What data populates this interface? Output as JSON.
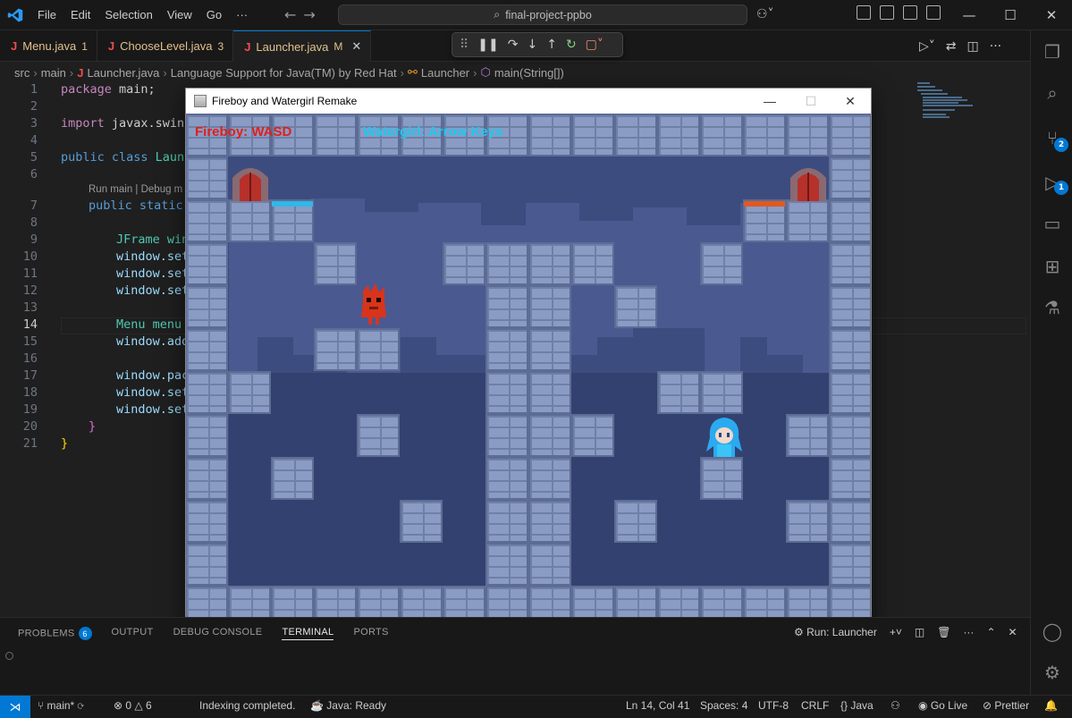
{
  "titlebar": {
    "menu": [
      "File",
      "Edit",
      "Selection",
      "View",
      "Go",
      "···"
    ],
    "search_text": "final-project-ppbo"
  },
  "tabs": [
    {
      "label": "Menu.java",
      "status": "1"
    },
    {
      "label": "ChooseLevel.java",
      "status": "3"
    },
    {
      "label": "Launcher.java",
      "status": "M"
    }
  ],
  "breadcrumb": [
    "src",
    "main",
    "Launcher.java",
    "Language Support for Java(TM) by Red Hat",
    "Launcher",
    "main(String[])"
  ],
  "editor": {
    "line_numbers": [
      "1",
      "2",
      "3",
      "4",
      "5",
      "6",
      "7",
      "8",
      "9",
      "10",
      "11",
      "12",
      "13",
      "14",
      "15",
      "16",
      "17",
      "18",
      "19",
      "20",
      "21"
    ],
    "codelens": "Run main | Debug m",
    "lines": {
      "l1_kw": "package",
      "l1_rest": " main;",
      "l3_kw": "import",
      "l3_rest": " javax.swing",
      "l5_kw": "public class",
      "l5_rest": " Launc",
      "l7_kw": "public static",
      "l9": "JFrame win",
      "l10": "window.set",
      "l11": "window.set",
      "l12": "window.set",
      "l14": "Menu menu",
      "l15": "window.add",
      "l17": "window.pac",
      "l18": "window.set",
      "l19": "window.set",
      "l20": "}",
      "l21": "}"
    }
  },
  "panel": {
    "tabs": [
      "PROBLEMS",
      "OUTPUT",
      "DEBUG CONSOLE",
      "TERMINAL",
      "PORTS"
    ],
    "problems_count": "6",
    "run_label": "Run: Launcher"
  },
  "statusbar": {
    "branch": "main*",
    "errors": "0",
    "warnings": "6",
    "indexing": "Indexing completed.",
    "java_status": "Java: Ready",
    "position": "Ln 14, Col 41",
    "spaces": "Spaces: 4",
    "encoding": "UTF-8",
    "eol": "CRLF",
    "language": "Java",
    "golive": "Go Live",
    "prettier": "Prettier"
  },
  "activity_badges": {
    "scm": "2",
    "debug": "1"
  },
  "game_window": {
    "title": "Fireboy and Watergirl Remake",
    "hud_fireboy": "Fireboy: WASD",
    "hud_watergirl": "Watergirl: Arrow Keys",
    "colors": {
      "fireboy": "#e0201a",
      "watergirl": "#1ec8f0",
      "background": "#3a4a7a"
    }
  },
  "colors": {
    "accent": "#0078d4",
    "editor_bg": "#1f1f1f",
    "chrome_bg": "#181818"
  }
}
